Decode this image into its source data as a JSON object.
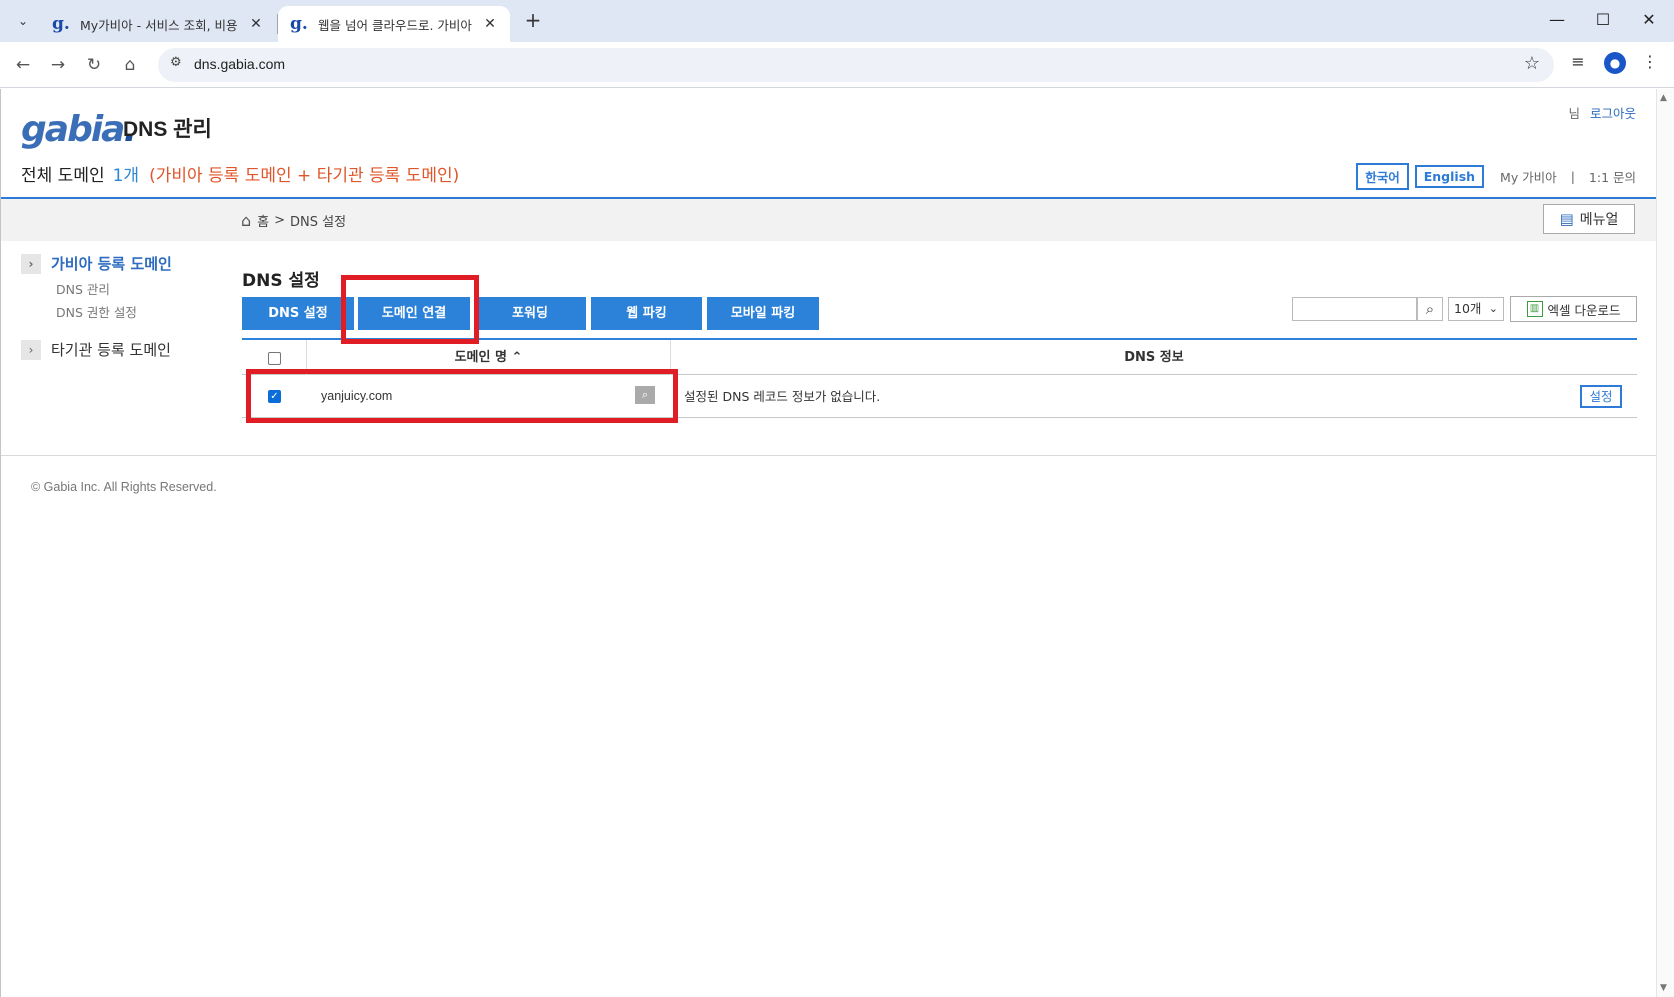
{
  "browser": {
    "tabs": [
      {
        "title": "My가비아 - 서비스 조회, 비용",
        "active": false
      },
      {
        "title": "웹을 넘어 클라우드로. 가비아",
        "active": true
      }
    ],
    "url": "dns.gabia.com",
    "new_tab": "+",
    "close": "✕",
    "window": {
      "minimize": "—",
      "maximize": "☐",
      "close": "✕"
    }
  },
  "header": {
    "logo_text": "gabia",
    "logo_dot": ".",
    "title": "DNS 관리",
    "user_suffix": "님",
    "logout": "로그아웃",
    "summary_label": "전체 도메인",
    "summary_count": "1개",
    "summary_note": "(가비아 등록 도메인 + 타기관 등록 도메인)",
    "lang": [
      "한국어",
      "English"
    ],
    "my_link": "My 가비아",
    "separator": "|",
    "inquiry_link": "1:1 문의"
  },
  "breadcrumb": {
    "home": "홈",
    "sep": ">",
    "current": "DNS 설정"
  },
  "manual_label": "메뉴얼",
  "left_nav": {
    "gabia_domains": "가비아 등록 도메인",
    "sub": [
      "DNS 관리",
      "DNS 권한 설정"
    ],
    "other_domains": "타기관 등록 도메인"
  },
  "main": {
    "section_title": "DNS 설정",
    "tabs": [
      "DNS 설정",
      "도메인 연결",
      "포워딩",
      "웹 파킹",
      "모바일 파킹"
    ],
    "count_select": "10개",
    "excel_label": "엑셀 다운로드",
    "table": {
      "headers": [
        "도메인 명 ⌃",
        "DNS 정보"
      ],
      "rows": [
        {
          "checked": true,
          "domain": "yanjuicy.com",
          "info": "설정된 DNS 레코드 정보가 없습니다.",
          "action": "설정"
        }
      ]
    }
  },
  "footer": {
    "copyright": "© Gabia Inc. All Rights Reserved."
  },
  "colors": {
    "accent": "#2c82d8",
    "highlight": "#e01d24",
    "note": "#e0562b"
  }
}
